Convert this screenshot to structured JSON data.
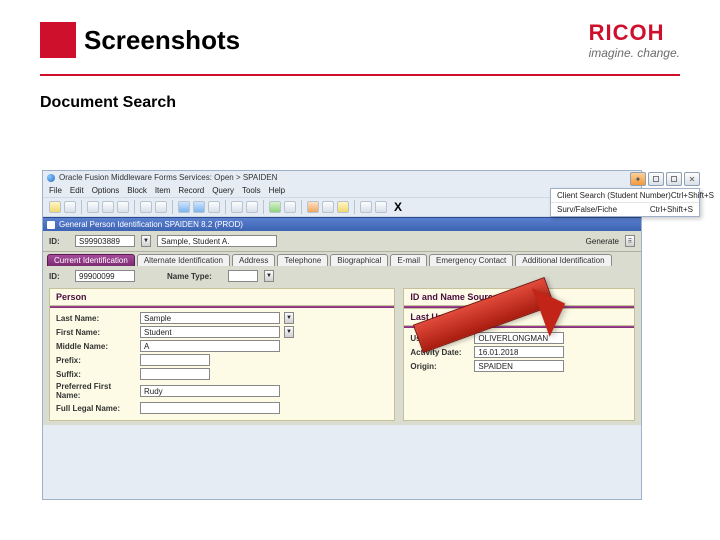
{
  "header": {
    "title": "Screenshots"
  },
  "logo": {
    "brand": "RICOH",
    "tagline": "imagine. change."
  },
  "subtitle": "Document Search",
  "win": {
    "title": "Oracle Fusion Middleware Forms Services: Open > SPAIDEN",
    "menu": [
      "File",
      "Edit",
      "Options",
      "Block",
      "Item",
      "Record",
      "Query",
      "Tools",
      "Help"
    ],
    "close_x": "X"
  },
  "subwin": {
    "title": "General Person Identification SPAIDEN 8.2 (PROD)"
  },
  "keyblock": {
    "id_label": "ID:",
    "id_value": "S99903889",
    "name_value": "Sample, Student A.",
    "generate_label": "Generate"
  },
  "tabs": [
    {
      "label": "Current Identification",
      "active": true
    },
    {
      "label": "Alternate Identification"
    },
    {
      "label": "Address"
    },
    {
      "label": "Telephone"
    },
    {
      "label": "Biographical"
    },
    {
      "label": "E-mail"
    },
    {
      "label": "Emergency Contact"
    },
    {
      "label": "Additional Identification"
    }
  ],
  "idrow": {
    "id_label": "ID:",
    "id_value": "99900099",
    "nt_label": "Name Type:",
    "nt_value": ""
  },
  "person": {
    "section": "Person",
    "last_label": "Last Name:",
    "last_value": "Sample",
    "first_label": "First Name:",
    "first_value": "Student",
    "middle_label": "Middle Name:",
    "middle_value": "A",
    "prefix_label": "Prefix:",
    "prefix_value": "",
    "suffix_label": "Suffix:",
    "suffix_value": "",
    "pref_label": "Preferred First Name:",
    "pref_value": "Rudy",
    "full_label": "Full Legal Name:",
    "full_value": ""
  },
  "source": {
    "section1": "ID and Name Source",
    "section2": "Last Update",
    "user_label": "User:",
    "user_value": "OLIVERLONGMAN",
    "date_label": "Activity Date:",
    "date_value": "16.01.2018",
    "origin_label": "Origin:",
    "origin_value": "SPAIDEN"
  },
  "context": {
    "row1": {
      "label": "Client Search (Student Number)",
      "accel": "Ctrl+Shift+S"
    },
    "row2": {
      "label": "Surv/False/Fiche",
      "accel": "Ctrl+Shift+S"
    }
  }
}
